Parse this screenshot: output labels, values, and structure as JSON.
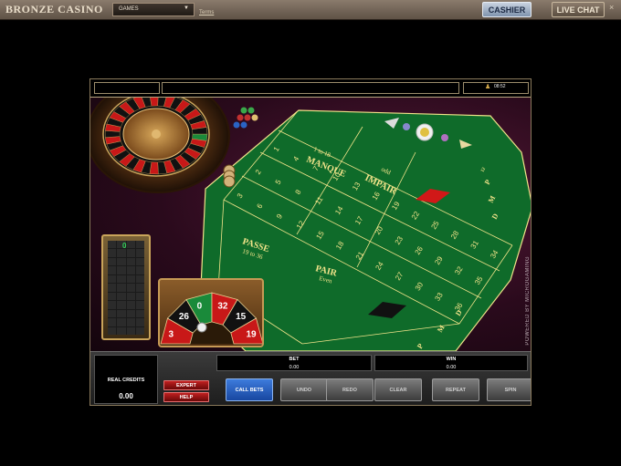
{
  "topbar": {
    "brand": "BRONZE CASINO",
    "games_select": "GAMES",
    "terms": "Terms",
    "cashier": "CASHIER",
    "live_chat": "LIVE CHAT",
    "close": "×"
  },
  "game": {
    "clock": "08:52",
    "powered_by": "POWERED BY MICROGAMING",
    "history_last": "0",
    "mini_wheel_numbers": [
      "3",
      "26",
      "0",
      "32",
      "15",
      "19"
    ],
    "table": {
      "manque": "MANQUE",
      "manque_sub": "1 to 18",
      "impair": "IMPAIR",
      "impair_sub": "odd",
      "passe": "PASSE",
      "passe_sub": "19 to 36",
      "pair": "PAIR",
      "pair_sub": "Even",
      "dozen_top": [
        "P",
        "M",
        "D"
      ],
      "dozen_bottom": [
        "P",
        "M",
        "D"
      ],
      "dozen_sup": "12"
    }
  },
  "controls": {
    "real_credits_label": "REAL CREDITS",
    "real_credits_value": "0.00",
    "expert": "EXPERT",
    "help": "HELP",
    "bet_label": "BET",
    "bet_value": "0.00",
    "win_label": "WIN",
    "win_value": "0.00",
    "buttons": [
      "CALL BETS",
      "UNDO",
      "REDO",
      "CLEAR",
      "REPEAT",
      "SPIN"
    ]
  },
  "colors": {
    "felt": "#0f6b2a",
    "felt_line": "#f2e48a",
    "red": "#d11818",
    "black": "#111111",
    "accent_blue": "#2a63c4"
  }
}
